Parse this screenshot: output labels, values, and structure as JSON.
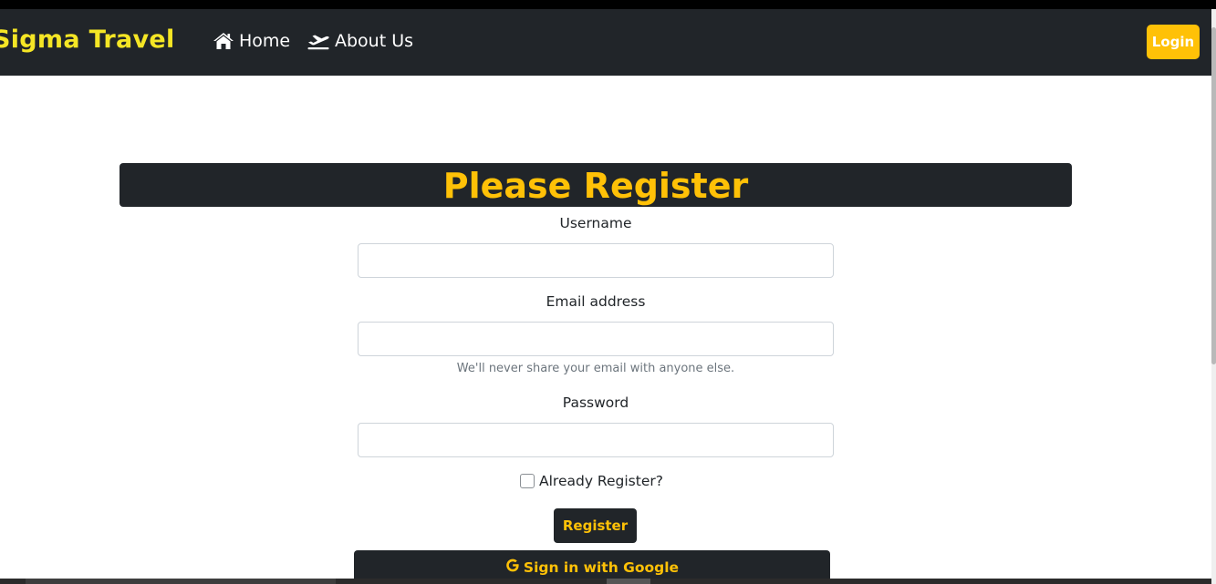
{
  "navbar": {
    "brand": "Sigma Travel",
    "links": [
      {
        "label": "Home",
        "icon": "home-icon"
      },
      {
        "label": "About Us",
        "icon": "plane-departure-icon"
      }
    ],
    "login_label": "Login"
  },
  "form": {
    "title": "Please Register",
    "username": {
      "label": "Username",
      "value": "",
      "placeholder": ""
    },
    "email": {
      "label": "Email address",
      "value": "",
      "placeholder": "",
      "help": "We'll never share your email with anyone else."
    },
    "password": {
      "label": "Password",
      "value": "",
      "placeholder": ""
    },
    "already_registered": {
      "label": "Already Register?",
      "checked": false
    },
    "register_label": "Register",
    "google_label": "Sign in with Google"
  },
  "colors": {
    "navbar_bg": "#212529",
    "brand": "#f5e625",
    "accent": "#ffc107"
  }
}
